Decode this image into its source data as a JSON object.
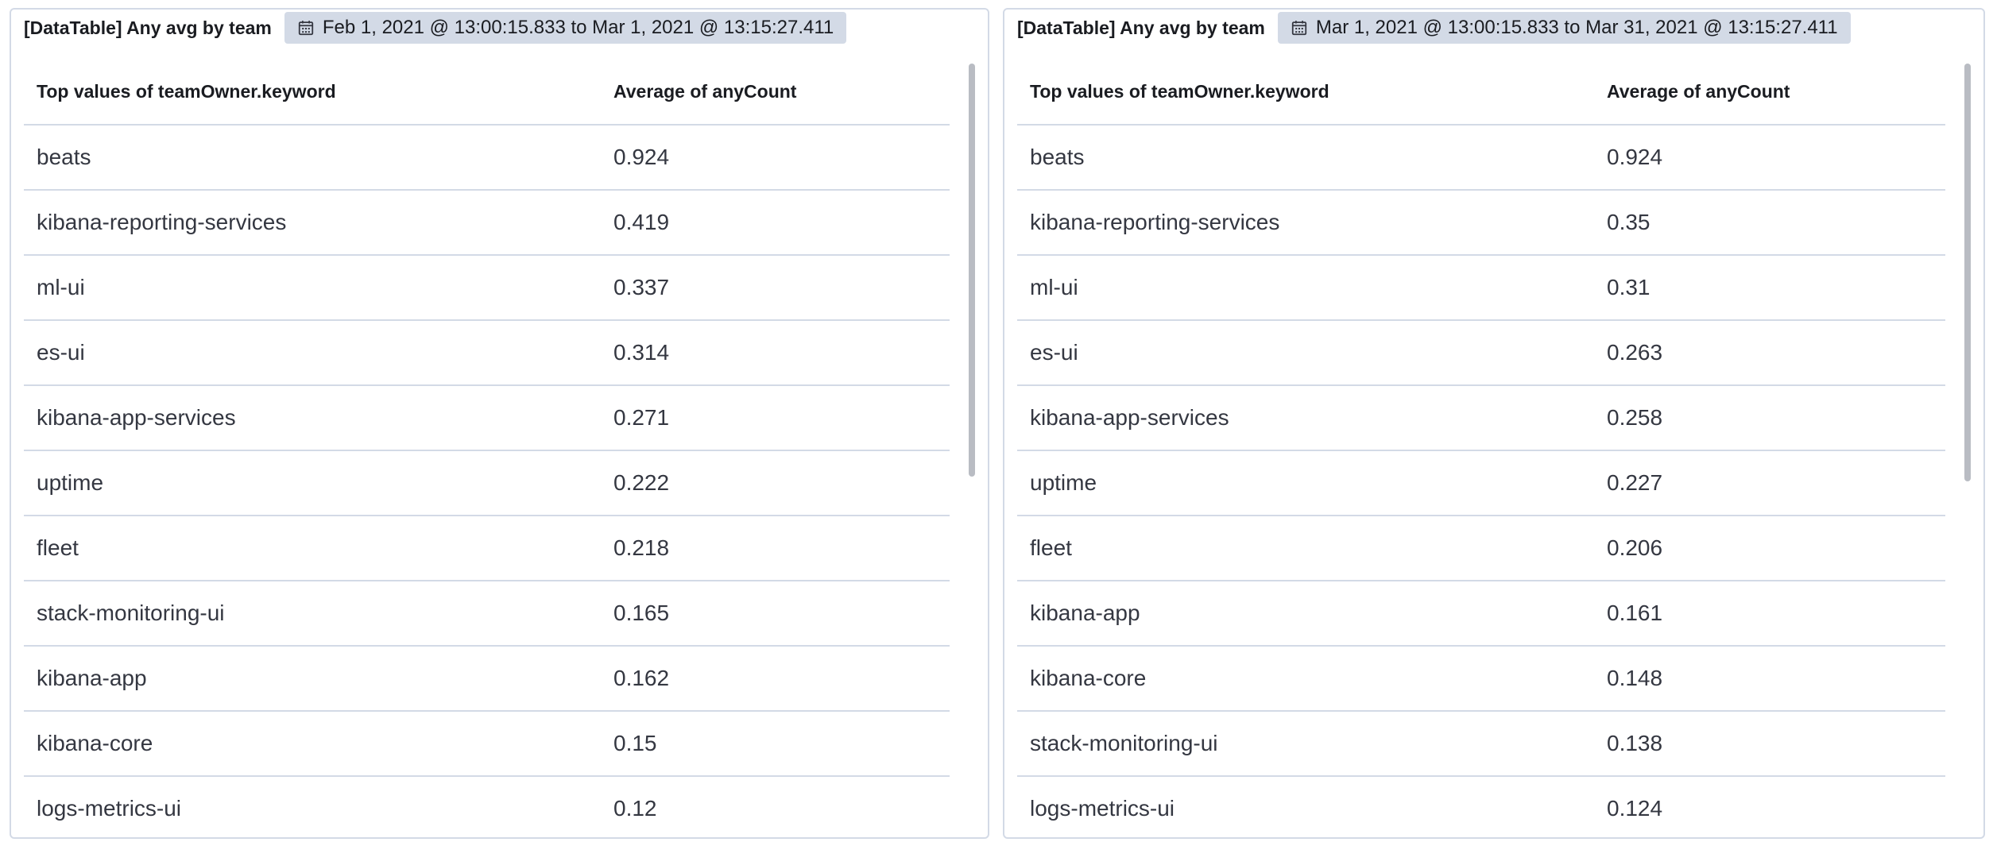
{
  "panels": [
    {
      "title": "[DataTable] Any avg by team",
      "time_range": "Feb 1, 2021 @ 13:00:15.833 to Mar 1, 2021 @ 13:15:27.411",
      "columns": [
        "Top values of teamOwner.keyword",
        "Average of anyCount"
      ],
      "rows": [
        [
          "beats",
          "0.924"
        ],
        [
          "kibana-reporting-services",
          "0.419"
        ],
        [
          "ml-ui",
          "0.337"
        ],
        [
          "es-ui",
          "0.314"
        ],
        [
          "kibana-app-services",
          "0.271"
        ],
        [
          "uptime",
          "0.222"
        ],
        [
          "fleet",
          "0.218"
        ],
        [
          "stack-monitoring-ui",
          "0.165"
        ],
        [
          "kibana-app",
          "0.162"
        ],
        [
          "kibana-core",
          "0.15"
        ],
        [
          "logs-metrics-ui",
          "0.12"
        ]
      ]
    },
    {
      "title": "[DataTable] Any avg by team",
      "time_range": "Mar 1, 2021 @ 13:00:15.833 to Mar 31, 2021 @ 13:15:27.411",
      "columns": [
        "Top values of teamOwner.keyword",
        "Average of anyCount"
      ],
      "rows": [
        [
          "beats",
          "0.924"
        ],
        [
          "kibana-reporting-services",
          "0.35"
        ],
        [
          "ml-ui",
          "0.31"
        ],
        [
          "es-ui",
          "0.263"
        ],
        [
          "kibana-app-services",
          "0.258"
        ],
        [
          "uptime",
          "0.227"
        ],
        [
          "fleet",
          "0.206"
        ],
        [
          "kibana-app",
          "0.161"
        ],
        [
          "kibana-core",
          "0.148"
        ],
        [
          "stack-monitoring-ui",
          "0.138"
        ],
        [
          "logs-metrics-ui",
          "0.124"
        ]
      ]
    }
  ],
  "icons": {
    "time_badge_icon": "calendar-icon"
  },
  "colors": {
    "badge_background": "#d3dae6",
    "row_divider": "#d3dae6",
    "panel_border": "#d3dae6",
    "text_primary": "#1a1c21",
    "scrollbar": "#b9bcc3"
  }
}
